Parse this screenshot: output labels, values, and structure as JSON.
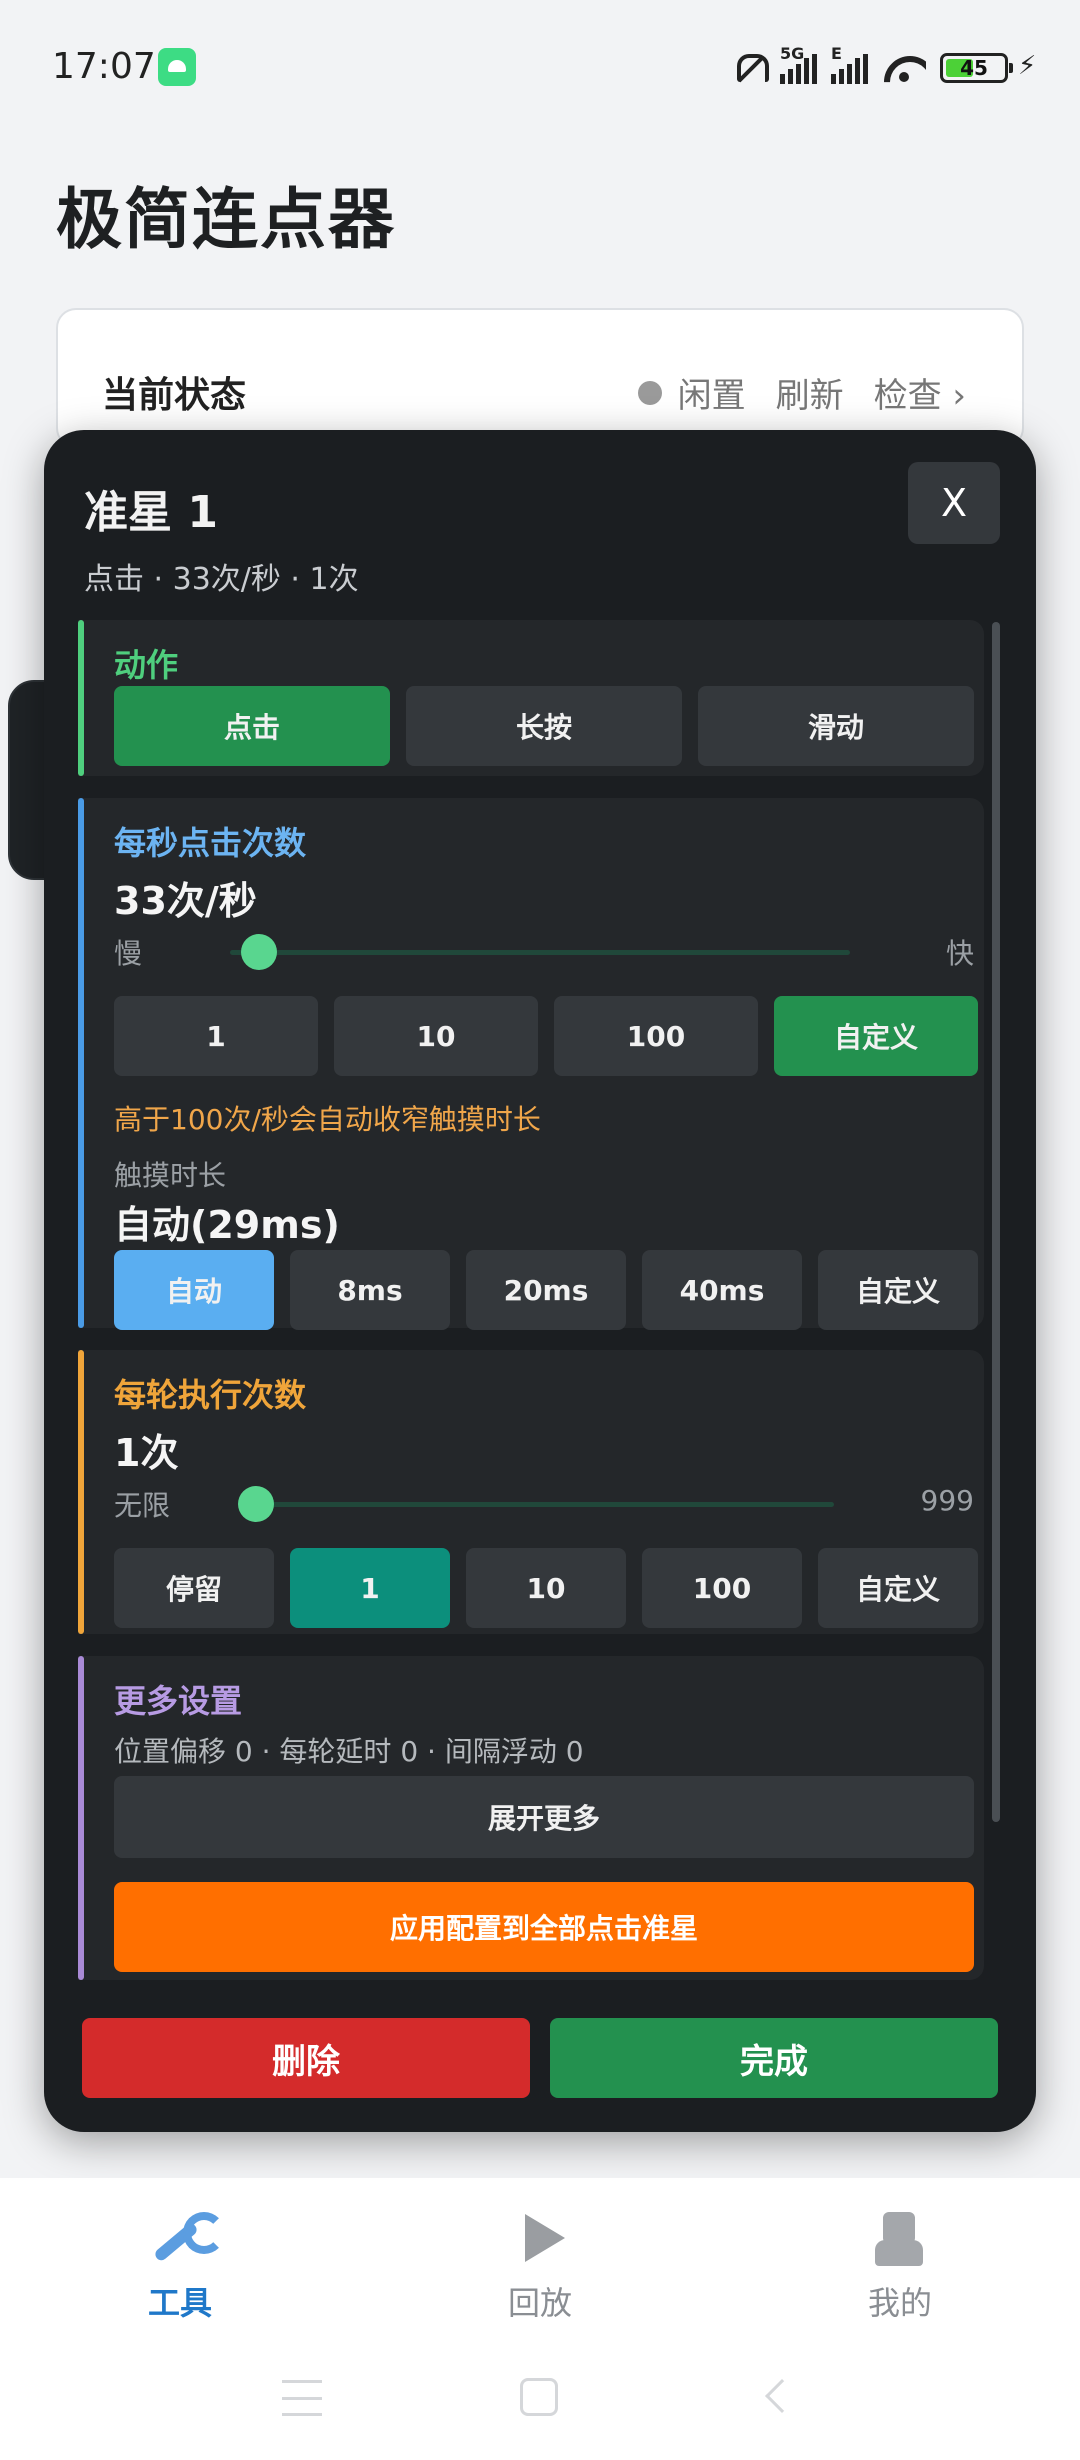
{
  "status_bar": {
    "time": "17:07",
    "signal1_tag": "5G",
    "signal2_tag": "E",
    "battery": "45"
  },
  "app": {
    "title": "极简连点器"
  },
  "status_card": {
    "label": "当前状态",
    "state": "闲置",
    "refresh": "刷新",
    "check": "检查 ›"
  },
  "modal": {
    "title": "准星 1",
    "subtitle": "点击 · 33次/秒 · 1次",
    "close": "X",
    "action": {
      "title": "动作",
      "buttons": [
        "点击",
        "长按",
        "滑动"
      ]
    },
    "cps": {
      "title": "每秒点击次数",
      "value": "33次/秒",
      "slider_min": "慢",
      "slider_max": "快",
      "slider_level": 0.03,
      "presets": [
        "1",
        "10",
        "100",
        "自定义"
      ],
      "note": "高于100次/秒会自动收窄触摸时长",
      "touch_label": "触摸时长",
      "touch_value": "自动(29ms)",
      "touch_presets": [
        "自动",
        "8ms",
        "20ms",
        "40ms",
        "自定义"
      ]
    },
    "rounds": {
      "title": "每轮执行次数",
      "value": "1次",
      "slider_min": "无限",
      "slider_max": "999",
      "slider_level": 0.0,
      "presets": [
        "停留",
        "1",
        "10",
        "100",
        "自定义"
      ]
    },
    "more": {
      "title": "更多设置",
      "info": "位置偏移 0 · 每轮延时 0 · 间隔浮动 0",
      "expand": "展开更多",
      "apply": "应用配置到全部点击准星"
    },
    "delete": "删除",
    "done": "完成"
  },
  "bottom_nav": {
    "items": [
      {
        "label": "工具",
        "icon": "wrench-icon"
      },
      {
        "label": "回放",
        "icon": "play-icon"
      },
      {
        "label": "我的",
        "icon": "user-icon"
      }
    ]
  },
  "colors": {
    "action_bar": "#4fcf7e",
    "cps_bar": "#4a9be6",
    "rounds_bar": "#f0a53a",
    "more_bar": "#a98ad6",
    "accent_green": "#23914f",
    "delete_red": "#d42b2b",
    "apply_orange": "#ff6f00"
  }
}
